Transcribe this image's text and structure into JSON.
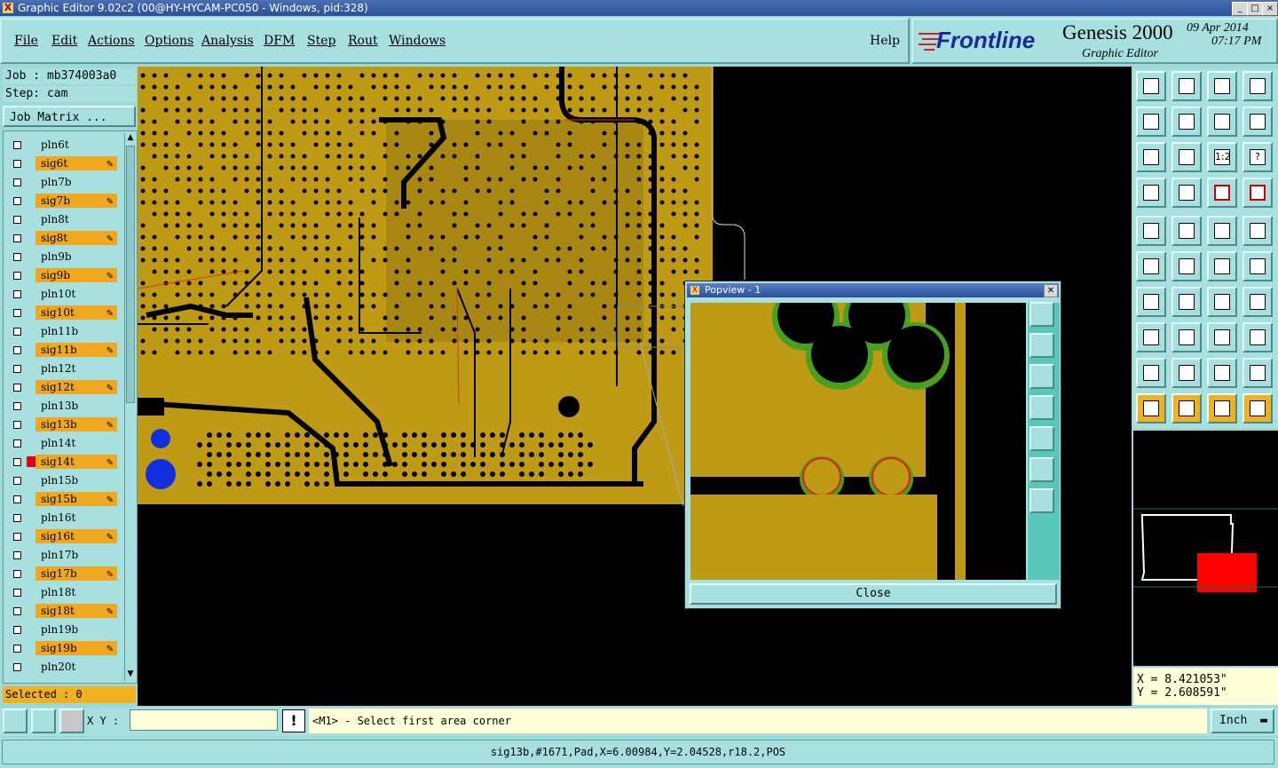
{
  "window": {
    "title": "Graphic Editor 9.02c2 (00@HY-HYCAM-PC050 - Windows, pid:328)",
    "min": "_",
    "max": "□",
    "close": "×"
  },
  "menu": {
    "items": [
      "File",
      "Edit",
      "Actions",
      "Options",
      "Analysis",
      "DFM",
      "Step",
      "Rout",
      "Windows"
    ],
    "help": "Help"
  },
  "brand": {
    "name": "Frontline",
    "product": "Genesis 2000",
    "sub": "Graphic Editor",
    "date": "09 Apr 2014",
    "time": "07:17 PM"
  },
  "job": {
    "job": "Job : mb374003a0",
    "step": "Step: cam",
    "matrix_button": "Job Matrix ..."
  },
  "layers": [
    {
      "name": "pln6t",
      "type": "pln"
    },
    {
      "name": "sig6t",
      "type": "sig"
    },
    {
      "name": "pln7b",
      "type": "pln"
    },
    {
      "name": "sig7b",
      "type": "sig"
    },
    {
      "name": "pln8t",
      "type": "pln"
    },
    {
      "name": "sig8t",
      "type": "sig"
    },
    {
      "name": "pln9b",
      "type": "pln"
    },
    {
      "name": "sig9b",
      "type": "sig"
    },
    {
      "name": "pln10t",
      "type": "pln"
    },
    {
      "name": "sig10t",
      "type": "sig"
    },
    {
      "name": "pln11b",
      "type": "pln"
    },
    {
      "name": "sig11b",
      "type": "sig"
    },
    {
      "name": "pln12t",
      "type": "pln"
    },
    {
      "name": "sig12t",
      "type": "sig"
    },
    {
      "name": "pln13b",
      "type": "pln"
    },
    {
      "name": "sig13b",
      "type": "sig"
    },
    {
      "name": "pln14t",
      "type": "pln"
    },
    {
      "name": "sig14t",
      "type": "sig",
      "active": true
    },
    {
      "name": "pln15b",
      "type": "pln"
    },
    {
      "name": "sig15b",
      "type": "sig"
    },
    {
      "name": "pln16t",
      "type": "pln"
    },
    {
      "name": "sig16t",
      "type": "sig"
    },
    {
      "name": "pln17b",
      "type": "pln"
    },
    {
      "name": "sig17b",
      "type": "sig"
    },
    {
      "name": "pln18t",
      "type": "pln"
    },
    {
      "name": "sig18t",
      "type": "sig"
    },
    {
      "name": "pln19b",
      "type": "pln"
    },
    {
      "name": "sig19b",
      "type": "sig"
    },
    {
      "name": "pln20t",
      "type": "pln"
    }
  ],
  "selected": "Selected : 0",
  "coords": {
    "x": "X = 8.421053\"",
    "y": "Y = 2.608591\""
  },
  "xy_label": "X Y :",
  "prompt": "<M1> - Select first area corner",
  "units": "Inch",
  "status": "sig13b,#1671,Pad,X=6.00984,Y=2.04528,r18.2,POS",
  "popview": {
    "title": "Popview - 1",
    "close_button": "Close"
  },
  "toolbar_labels": {
    "ratio": "1:2",
    "help": "?"
  }
}
